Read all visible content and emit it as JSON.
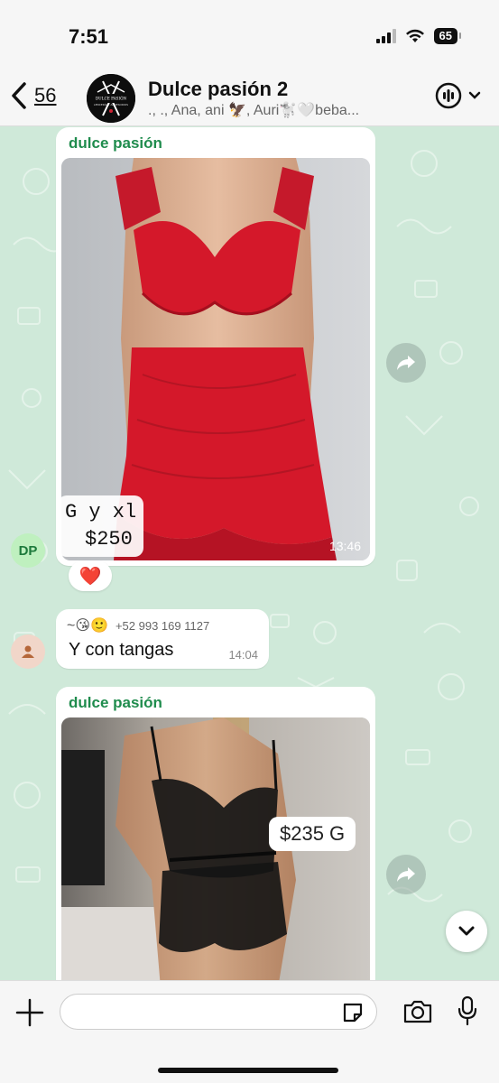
{
  "status_bar": {
    "time": "7:51",
    "battery": "65"
  },
  "header": {
    "back_count": "56",
    "title": "Dulce pasión 2",
    "members": "., ., Ana, ani 🦅, Auri🐩🤍beba...",
    "avatar_text": "DULCE PASIÓN",
    "avatar_subtext": "LENCERÍA Y ACCESORIOS",
    "icons": [
      "back-chevron-icon",
      "call-icon",
      "chevron-down-icon"
    ]
  },
  "messages": [
    {
      "type": "image",
      "sender": "dulce pasión",
      "price_line1": "G y xl",
      "price_line2": "$250",
      "time": "13:46",
      "reaction": "❤️",
      "avatar_initials": "DP",
      "photo_colors": {
        "background": "#c9ccd0",
        "garment": "#d4182a",
        "skin": "#e2b79c"
      }
    },
    {
      "type": "text",
      "sender_emojis": "~😘🙂",
      "sender_phone": "+52 993 169 1127",
      "text": "Y con tangas",
      "time": "14:04"
    },
    {
      "type": "image",
      "sender": "dulce pasión",
      "price_tag": "$235 G",
      "photo_colors": {
        "background": "#b9b7b2",
        "garment": "#151515",
        "skin": "#caa07e"
      }
    }
  ],
  "composer": {
    "placeholder": "",
    "icons": [
      "plus-icon",
      "sticker-icon",
      "camera-icon",
      "microphone-icon"
    ]
  },
  "colors": {
    "accent_green": "#1f8c4d",
    "wallpaper": "#cfe9d9",
    "bar": "#f6f6f6"
  }
}
